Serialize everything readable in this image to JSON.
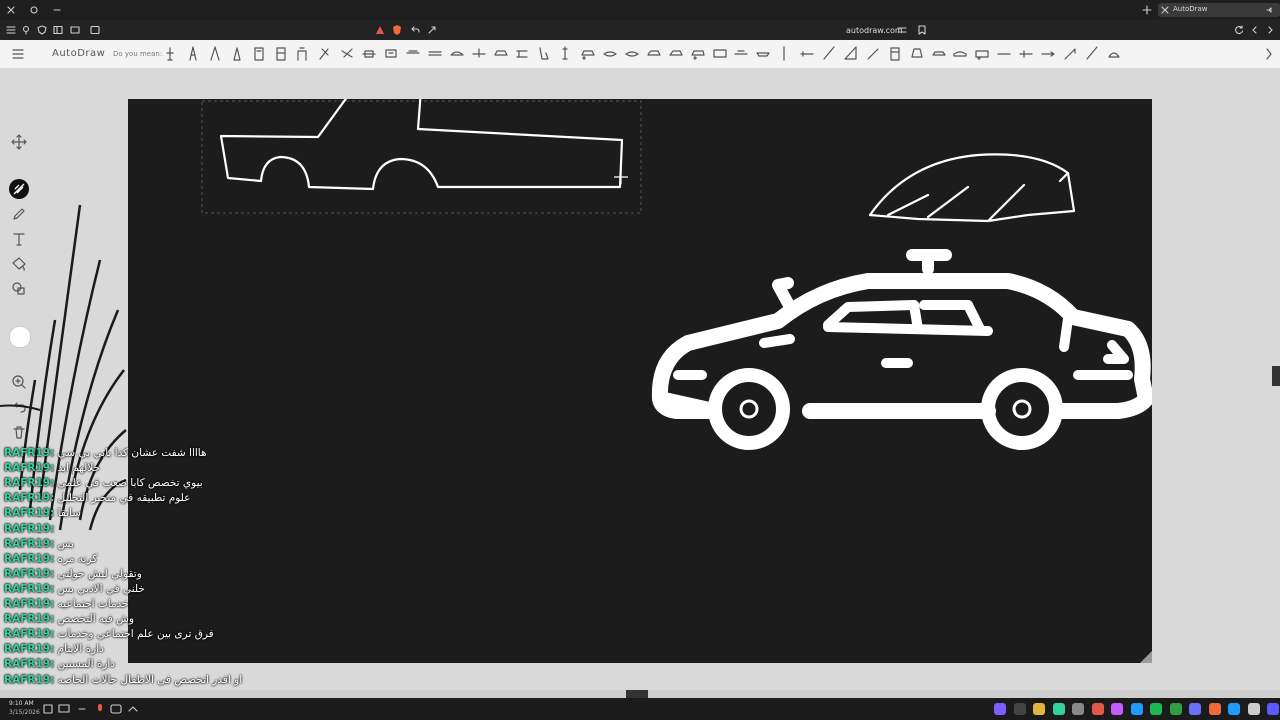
{
  "browser": {
    "tab_title": "AutoDraw",
    "address": "autodraw.com"
  },
  "app": {
    "title": "AutoDraw",
    "suggest_label": "Do you mean:"
  },
  "chat": {
    "username": "RAFR19:",
    "messages": [
      "هاااا شفت عشان كذا بابي بي سي",
      "حلالهم ابد",
      "بيوي تخصص كابا صعب في علمي",
      "علوم تطبيقه في منحبر التحليل",
      "سابقا",
      "",
      "بس",
      "كرنه مره",
      "وتقولي ليش حولتي",
      "خلني في الادبي بس",
      "خدمات اجتماعيه",
      "وش فيه التخصص",
      "فرق ترى بين علم اجتماعي وخدمات",
      "دارة الايتام",
      "دارة المسنين",
      "او اقدر اتخصص فى الاطفال حالات الخاصه"
    ]
  },
  "taskbar": {
    "time": "9:10 AM",
    "date": "3/15/2026"
  },
  "colors": {
    "canvas": "#1c1c1c",
    "chat_user": "#36d19b",
    "browser_dark": "#1e1e1e"
  }
}
